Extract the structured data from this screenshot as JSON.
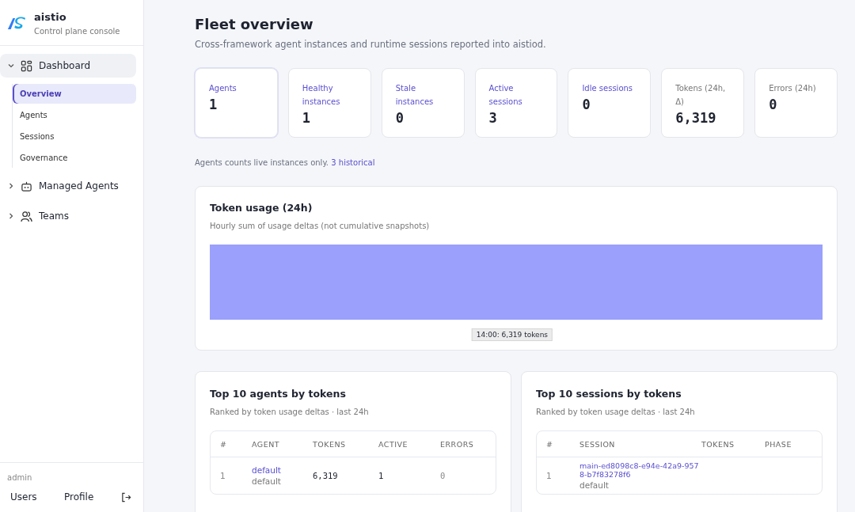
{
  "brand": {
    "name": "aistio",
    "subtitle": "Control plane console"
  },
  "nav": [
    {
      "label": "Dashboard",
      "expanded": true,
      "children": [
        {
          "label": "Overview",
          "selected": true
        },
        {
          "label": "Agents",
          "selected": false
        },
        {
          "label": "Sessions",
          "selected": false
        },
        {
          "label": "Governance",
          "selected": false
        }
      ]
    },
    {
      "label": "Managed Agents",
      "expanded": false
    },
    {
      "label": "Teams",
      "expanded": false
    }
  ],
  "footer": {
    "section": "admin",
    "links": [
      "Users",
      "Profile"
    ]
  },
  "page": {
    "title": "Fleet overview",
    "subtitle": "Cross-framework agent instances and runtime sessions reported into aistiod."
  },
  "stats": [
    {
      "label": "Agents",
      "value": "1",
      "link": true
    },
    {
      "label": "Healthy instances",
      "value": "1",
      "link": true
    },
    {
      "label": "Stale instances",
      "value": "0",
      "link": true
    },
    {
      "label": "Active sessions",
      "value": "3",
      "link": true
    },
    {
      "label": "Idle sessions",
      "value": "0",
      "link": true
    },
    {
      "label": "Tokens (24h, Δ)",
      "value": "6,319",
      "link": false
    },
    {
      "label": "Errors (24h)",
      "value": "0",
      "link": false
    }
  ],
  "note": {
    "text": "Agents counts live instances only.",
    "link": "3 historical"
  },
  "token_usage": {
    "title": "Token usage (24h)",
    "subtitle": "Hourly sum of usage deltas (not cumulative snapshots)",
    "tooltip": "14:00: 6,319 tokens"
  },
  "top_agents": {
    "title": "Top 10 agents by tokens",
    "subtitle": "Ranked by token usage deltas · last 24h",
    "columns": [
      "#",
      "AGENT",
      "TOKENS",
      "ACTIVE",
      "ERRORS"
    ],
    "rows": [
      {
        "rank": "1",
        "name": "default",
        "namespace": "default",
        "tokens": "6,319",
        "active": "1",
        "errors": "0"
      }
    ]
  },
  "top_sessions": {
    "title": "Top 10 sessions by tokens",
    "subtitle": "Ranked by token usage deltas · last 24h",
    "columns": [
      "#",
      "SESSION",
      "TOKENS",
      "PHASE"
    ],
    "rows": [
      {
        "rank": "1",
        "session": "main-ed8098c8-e94e-42a9-9578-b7f83278f6",
        "namespace": "default"
      }
    ]
  }
}
